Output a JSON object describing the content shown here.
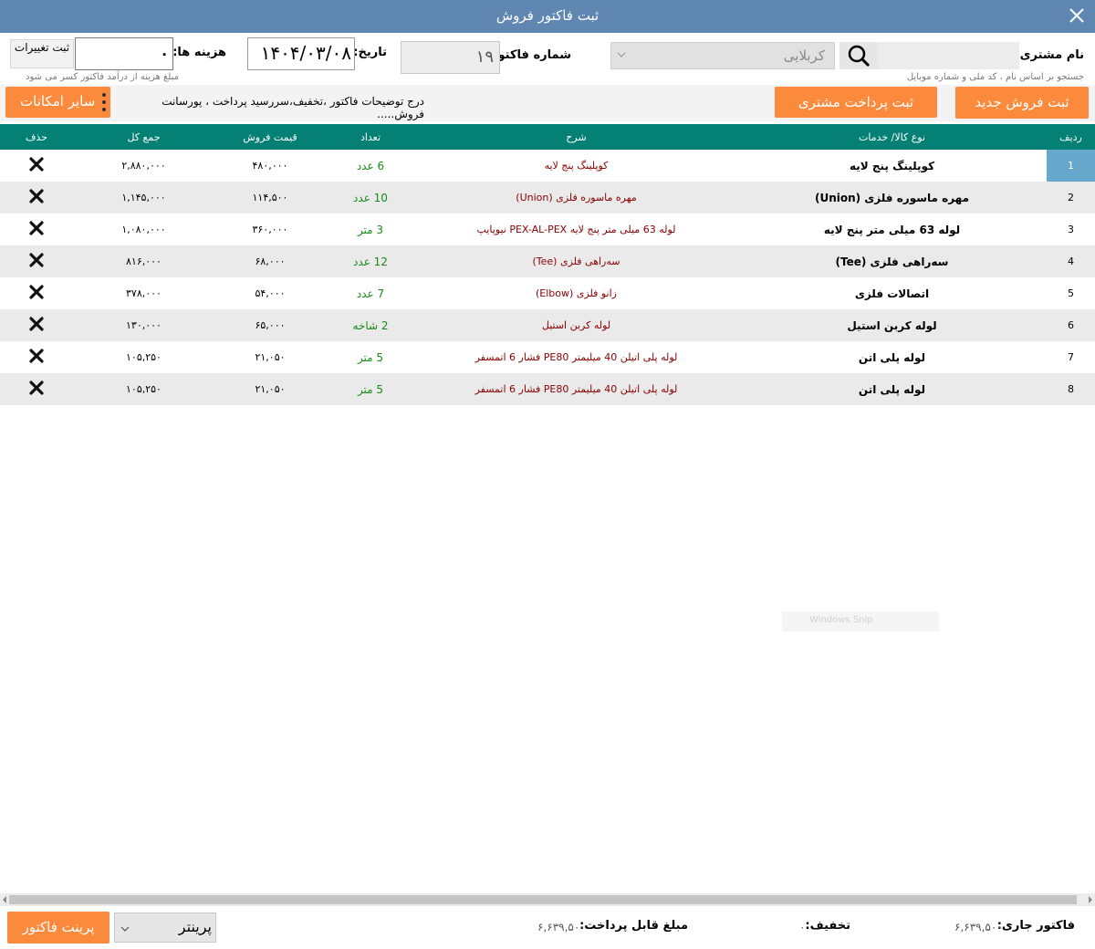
{
  "window": {
    "title": "ثبت فاکتور فروش"
  },
  "customer": {
    "label": "نام مشتری:",
    "selected": "کربلایی",
    "hint": "جستجو بر اساس نام ، کد ملی و شماره موبایل"
  },
  "invoice": {
    "number_label": "شماره فاکتور:",
    "number": "۱۹",
    "date_label": "تاریخ:",
    "date": "۱۴۰۴/۰۳/۰۸"
  },
  "cost": {
    "label": "هزینه ها:",
    "value": "۰",
    "hint": "مبلغ هزینه از درآمد فاکتور کسر می شود",
    "save_label": "ثبت تغییرات"
  },
  "toolbar": {
    "new_sale": "ثبت فروش جدید",
    "customer_payment": "ثبت پرداخت مشتری",
    "more_options": "سایر امکانات",
    "notes_link": "درج توضیحات فاکتور ،تخفیف،سررسید پرداخت ، پورسانت فروش....."
  },
  "table": {
    "headers": {
      "row": "ردیف",
      "item": "نوع کالا/ خدمات",
      "desc": "شرح",
      "qty": "تعداد",
      "price": "قیمت فروش",
      "total": "جمع کل",
      "delete": "حذف"
    },
    "rows": [
      {
        "n": "1",
        "item": "کوپلینگ پنج لایه",
        "desc": "کوپلینگ پنج لایه",
        "qty": "6 عدد",
        "price": "۴۸۰,۰۰۰",
        "total": "۲,۸۸۰,۰۰۰"
      },
      {
        "n": "2",
        "item": "مهره ماسوره فلزی (Union)",
        "desc": "مهره ماسوره فلزی (Union)",
        "qty": "10 عدد",
        "price": "۱۱۴,۵۰۰",
        "total": "۱,۱۴۵,۰۰۰"
      },
      {
        "n": "3",
        "item": "لوله 63 میلی متر پنج لایه",
        "desc": "لوله 63 میلی متر پنج لایه PEX-AL-PEX نیوپایپ",
        "qty": "3 متر",
        "price": "۳۶۰,۰۰۰",
        "total": "۱,۰۸۰,۰۰۰"
      },
      {
        "n": "4",
        "item": "سه‌راهی فلزی (Tee)",
        "desc": "سه‌راهی فلزی (Tee)",
        "qty": "12 عدد",
        "price": "۶۸,۰۰۰",
        "total": "۸۱۶,۰۰۰"
      },
      {
        "n": "5",
        "item": "اتصالات فلزی",
        "desc": "زانو فلزی (Elbow)",
        "qty": "7 عدد",
        "price": "۵۴,۰۰۰",
        "total": "۳۷۸,۰۰۰"
      },
      {
        "n": "6",
        "item": "لوله کربن استیل",
        "desc": "لوله کربن استیل",
        "qty": "2 شاخه",
        "price": "۶۵,۰۰۰",
        "total": "۱۳۰,۰۰۰"
      },
      {
        "n": "7",
        "item": "لوله پلی اتن",
        "desc": "لوله پلی اتیلن 40 میلیمتر PE80 فشار 6 اتمسفر",
        "qty": "5 متر",
        "price": "۲۱,۰۵۰",
        "total": "۱۰۵,۲۵۰"
      },
      {
        "n": "8",
        "item": "لوله پلی اتن",
        "desc": "لوله پلی اتیلن 40 میلیمتر PE80 فشار 6 اتمسفر",
        "qty": "5 متر",
        "price": "۲۱,۰۵۰",
        "total": "۱۰۵,۲۵۰"
      }
    ]
  },
  "watermark": {
    "text": "Windows Snip"
  },
  "footer": {
    "current_invoice_label": "فاکتور جاری:",
    "current_invoice_value": "۶,۶۳۹,۵۰۰",
    "discount_label": "تخفیف:",
    "discount_value": "۰",
    "payable_label": "مبلغ قابل پرداخت:",
    "payable_value": "۶,۶۳۹,۵۰۰",
    "printer_selected": "پرینتر",
    "print_button": "پرینت فاکتور"
  },
  "colors": {
    "titlebar": "#5f87b1",
    "header": "#058075",
    "accent_orange": "#fb8a3c",
    "selected_row": "#65a8cb",
    "desc_text": "#8b0000",
    "qty_text": "#178a17"
  },
  "icons": {
    "close": "close-icon",
    "search": "search-icon",
    "delete": "delete-x-icon",
    "dropdown": "chevron-down-icon",
    "more": "vertical-dots-icon"
  }
}
